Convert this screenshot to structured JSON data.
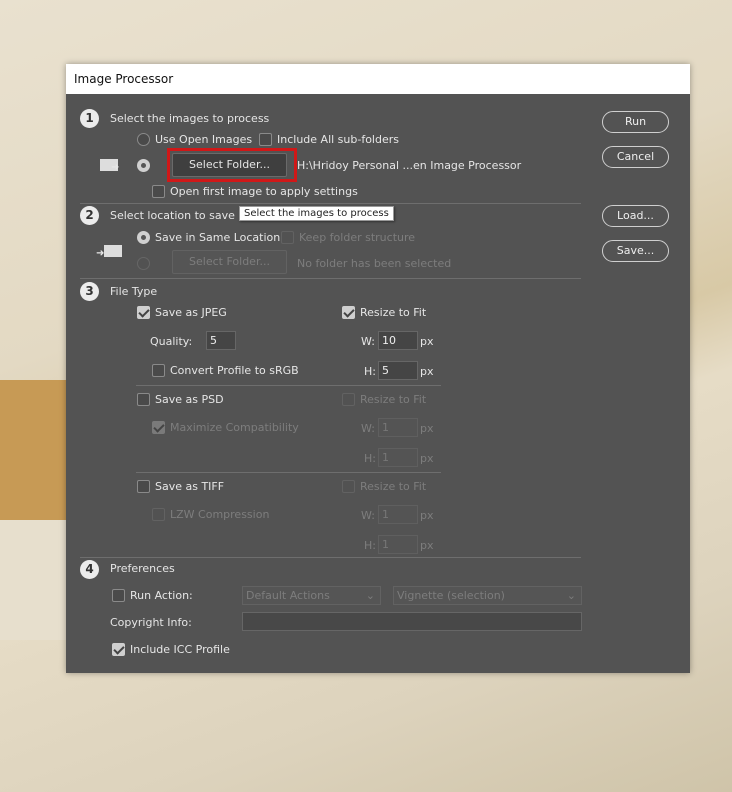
{
  "dialog": {
    "title": "Image Processor"
  },
  "section1": {
    "number": "1",
    "title": "Select the images to process",
    "use_open_images": "Use Open Images",
    "include_subfolders": "Include All sub-folders",
    "select_folder": "Select Folder...",
    "folder_path": "H:\\Hridoy Personal ...en Image Processor",
    "open_first_image": "Open first image to apply settings"
  },
  "tooltip": "Select the images to process",
  "section2": {
    "number": "2",
    "title": "Select location to save pro",
    "save_same": "Save in Same Location",
    "keep_structure": "Keep folder structure",
    "select_folder": "Select Folder...",
    "no_folder": "No folder has been selected"
  },
  "section3": {
    "number": "3",
    "title": "File Type",
    "jpeg": {
      "label": "Save as JPEG",
      "resize": "Resize to Fit",
      "quality_label": "Quality:",
      "quality": "5",
      "w_label": "W:",
      "w": "10",
      "h_label": "H:",
      "h": "5",
      "unit": "px",
      "convert": "Convert Profile to sRGB"
    },
    "psd": {
      "label": "Save as PSD",
      "resize": "Resize to Fit",
      "maximize": "Maximize Compatibility",
      "w_label": "W:",
      "w": "1",
      "h_label": "H:",
      "h": "1",
      "unit": "px"
    },
    "tiff": {
      "label": "Save as TIFF",
      "resize": "Resize to Fit",
      "lzw": "LZW Compression",
      "w_label": "W:",
      "w": "1",
      "h_label": "H:",
      "h": "1",
      "unit": "px"
    }
  },
  "section4": {
    "number": "4",
    "title": "Preferences",
    "run_action": "Run Action:",
    "action_set": "Default Actions",
    "action": "Vignette (selection)",
    "copyright_label": "Copyright Info:",
    "copyright": "",
    "include_icc": "Include ICC Profile"
  },
  "buttons": {
    "run": "Run",
    "cancel": "Cancel",
    "load": "Load...",
    "save": "Save..."
  }
}
